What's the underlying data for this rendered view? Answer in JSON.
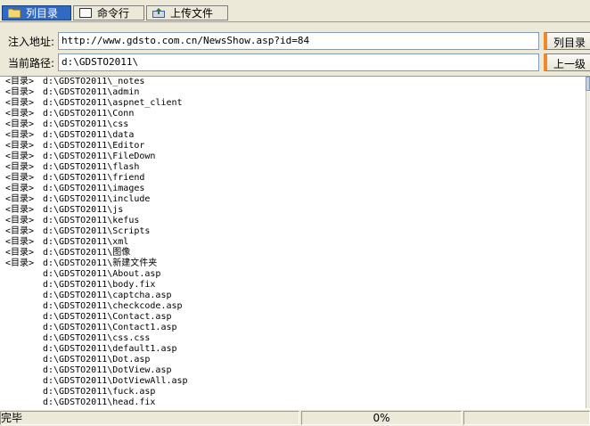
{
  "tabs": [
    {
      "label": "列目录",
      "icon": "folder-icon",
      "active": true
    },
    {
      "label": "命令行",
      "icon": "console-icon",
      "active": false
    },
    {
      "label": "上传文件",
      "icon": "upload-icon",
      "active": false
    }
  ],
  "inject": {
    "label": "注入地址:",
    "value": "http://www.gdsto.com.cn/NewsShow.asp?id=84",
    "button": "列目录"
  },
  "path": {
    "label": "当前路径:",
    "value": "d:\\GDSTO2011\\",
    "button": "上一级"
  },
  "dir_tag": "<目录>",
  "dirs": [
    "d:\\GDSTO2011\\_notes",
    "d:\\GDSTO2011\\admin",
    "d:\\GDSTO2011\\aspnet_client",
    "d:\\GDSTO2011\\Conn",
    "d:\\GDSTO2011\\css",
    "d:\\GDSTO2011\\data",
    "d:\\GDSTO2011\\Editor",
    "d:\\GDSTO2011\\FileDown",
    "d:\\GDSTO2011\\flash",
    "d:\\GDSTO2011\\friend",
    "d:\\GDSTO2011\\images",
    "d:\\GDSTO2011\\include",
    "d:\\GDSTO2011\\js",
    "d:\\GDSTO2011\\kefus",
    "d:\\GDSTO2011\\Scripts",
    "d:\\GDSTO2011\\xml",
    "d:\\GDSTO2011\\图像",
    "d:\\GDSTO2011\\新建文件夹"
  ],
  "files": [
    "d:\\GDSTO2011\\About.asp",
    "d:\\GDSTO2011\\body.fix",
    "d:\\GDSTO2011\\captcha.asp",
    "d:\\GDSTO2011\\checkcode.asp",
    "d:\\GDSTO2011\\Contact.asp",
    "d:\\GDSTO2011\\Contact1.asp",
    "d:\\GDSTO2011\\css.css",
    "d:\\GDSTO2011\\default1.asp",
    "d:\\GDSTO2011\\Dot.asp",
    "d:\\GDSTO2011\\DotView.asp",
    "d:\\GDSTO2011\\DotViewAll.asp",
    "d:\\GDSTO2011\\fuck.asp",
    "d:\\GDSTO2011\\head.fix"
  ],
  "status": {
    "text": "完毕",
    "progress": "0%"
  }
}
